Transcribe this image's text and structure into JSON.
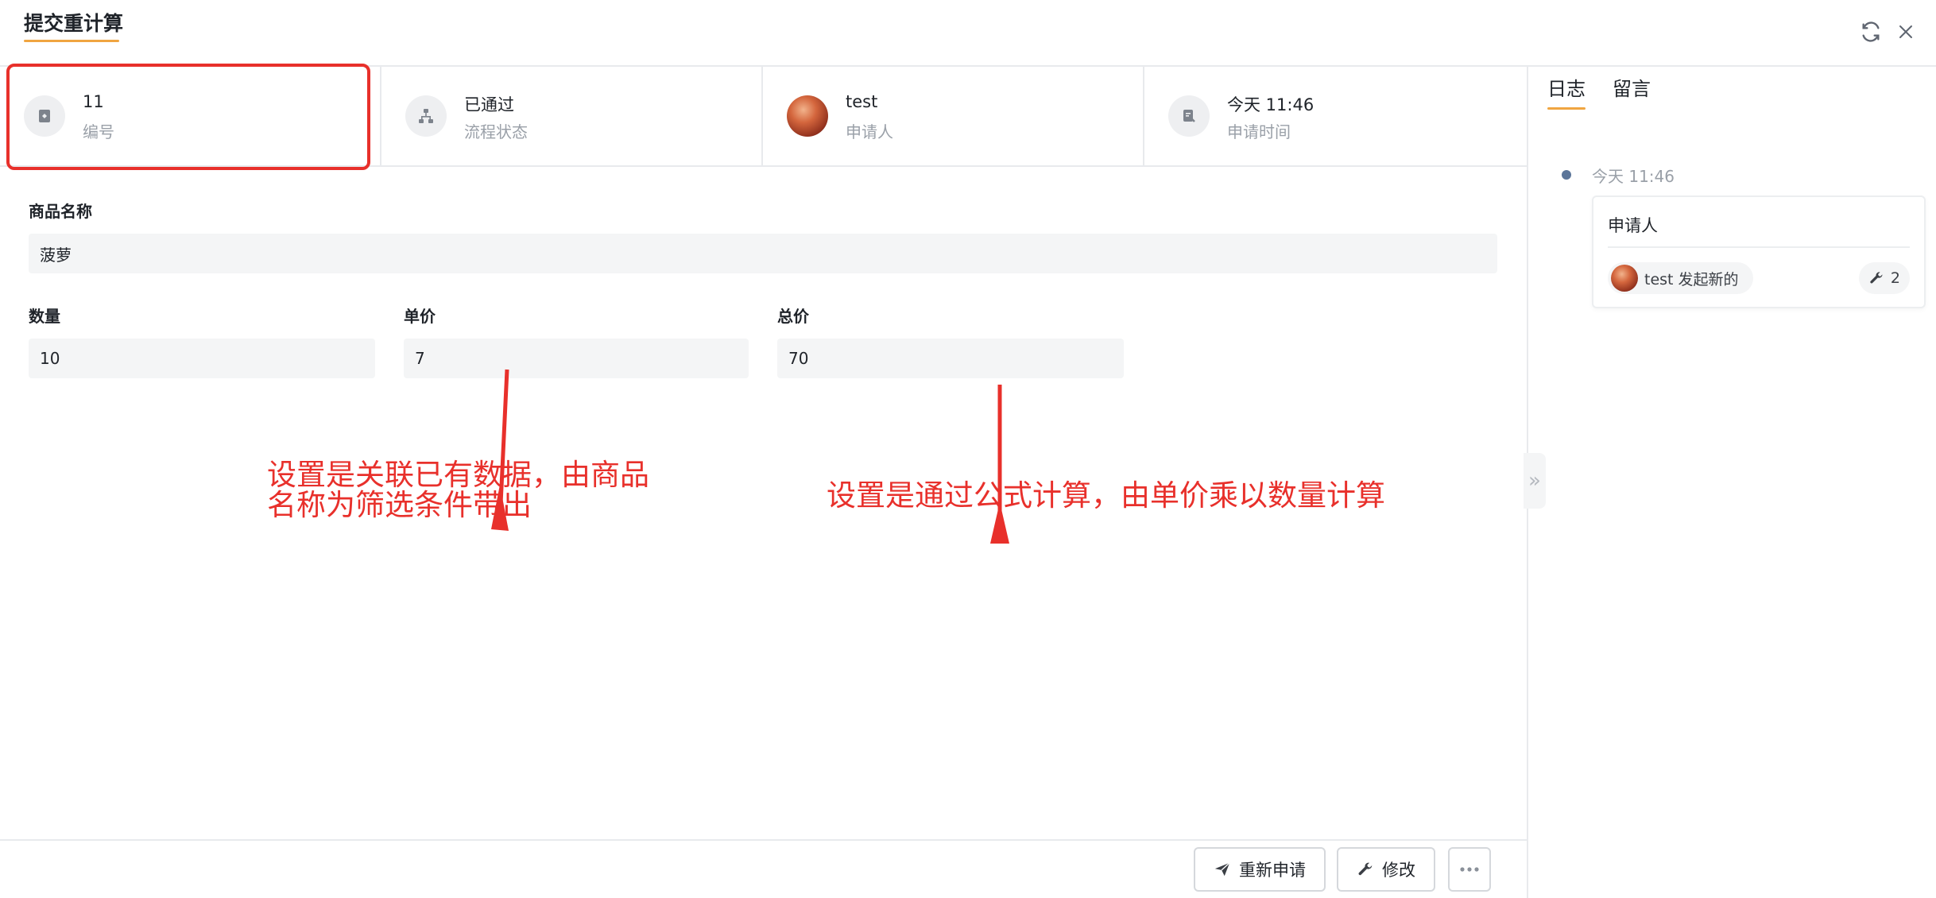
{
  "header": {
    "title": "提交重计算"
  },
  "info": [
    {
      "value": "11",
      "label": "编号",
      "icon": "form-icon"
    },
    {
      "value": "已通过",
      "label": "流程状态",
      "icon": "flow-icon"
    },
    {
      "value": "test",
      "label": "申请人",
      "icon": "avatar"
    },
    {
      "value": "今天 11:46",
      "label": "申请时间",
      "icon": "time-icon"
    }
  ],
  "form": {
    "product_name_label": "商品名称",
    "product_name_value": "菠萝",
    "quantity_label": "数量",
    "quantity_value": "10",
    "unit_price_label": "单价",
    "unit_price_value": "7",
    "total_label": "总价",
    "total_value": "70"
  },
  "annotations": {
    "left_line1": "设置是关联已有数据，由商品",
    "left_line2": "名称为筛选条件带出",
    "right": "设置是通过公式计算，由单价乘以数量计算"
  },
  "footer": {
    "resubmit_label": "重新申请",
    "modify_label": "修改"
  },
  "side": {
    "tab_log": "日志",
    "tab_comment": "留言",
    "timeline_time": "今天 11:46",
    "card_title": "申请人",
    "chip_text": "test 发起新的",
    "count": "2"
  },
  "colors": {
    "accent": "#f0a541",
    "annotation": "#e8302b",
    "field_bg": "#f4f5f6"
  }
}
